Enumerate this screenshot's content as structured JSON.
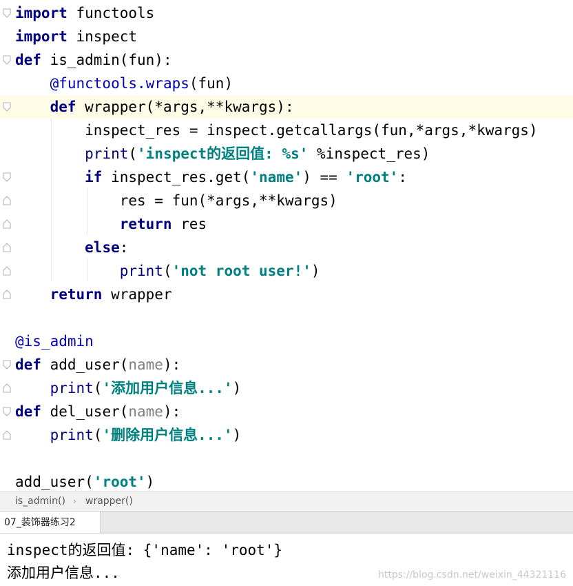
{
  "editor": {
    "lines": [
      {
        "id": "l1",
        "parts": [
          {
            "t": "import",
            "c": "kw"
          },
          {
            "t": " functools",
            "c": "self"
          }
        ]
      },
      {
        "id": "l2",
        "parts": [
          {
            "t": "import",
            "c": "kw"
          },
          {
            "t": " inspect",
            "c": "self"
          }
        ]
      },
      {
        "id": "l3",
        "parts": [
          {
            "t": "def",
            "c": "kw"
          },
          {
            "t": " is_admin(fun):",
            "c": "self"
          }
        ]
      },
      {
        "id": "l4",
        "parts": [
          {
            "t": "    ",
            "c": "self"
          },
          {
            "t": "@functools.wraps",
            "c": "deco"
          },
          {
            "t": "(fun)",
            "c": "self"
          }
        ]
      },
      {
        "id": "l5",
        "parts": [
          {
            "t": "    ",
            "c": "self"
          },
          {
            "t": "def",
            "c": "kw"
          },
          {
            "t": " wrapper(*args,**kwargs):",
            "c": "self"
          }
        ]
      },
      {
        "id": "l6",
        "parts": [
          {
            "t": "        inspect_res = inspect.getcallargs(fun,*args,*kwargs)",
            "c": "self"
          }
        ]
      },
      {
        "id": "l7",
        "parts": [
          {
            "t": "        ",
            "c": "self"
          },
          {
            "t": "print",
            "c": "bi"
          },
          {
            "t": "(",
            "c": "self"
          },
          {
            "t": "'inspect的返回值: %s'",
            "c": "str"
          },
          {
            "t": " %inspect_res)",
            "c": "self"
          }
        ]
      },
      {
        "id": "l8",
        "parts": [
          {
            "t": "        ",
            "c": "self"
          },
          {
            "t": "if",
            "c": "kw"
          },
          {
            "t": " inspect_res.get(",
            "c": "self"
          },
          {
            "t": "'name'",
            "c": "str"
          },
          {
            "t": ") == ",
            "c": "self"
          },
          {
            "t": "'root'",
            "c": "str"
          },
          {
            "t": ":",
            "c": "self"
          }
        ]
      },
      {
        "id": "l9",
        "parts": [
          {
            "t": "            res = fun(*args,**kwargs)",
            "c": "self"
          }
        ]
      },
      {
        "id": "l10",
        "parts": [
          {
            "t": "            ",
            "c": "self"
          },
          {
            "t": "return",
            "c": "kw"
          },
          {
            "t": " res",
            "c": "self"
          }
        ]
      },
      {
        "id": "l11",
        "parts": [
          {
            "t": "        ",
            "c": "self"
          },
          {
            "t": "else",
            "c": "kw"
          },
          {
            "t": ":",
            "c": "self"
          }
        ]
      },
      {
        "id": "l12",
        "parts": [
          {
            "t": "            ",
            "c": "self"
          },
          {
            "t": "print",
            "c": "bi"
          },
          {
            "t": "(",
            "c": "self"
          },
          {
            "t": "'not root user!'",
            "c": "str"
          },
          {
            "t": ")",
            "c": "self"
          }
        ]
      },
      {
        "id": "l13",
        "parts": [
          {
            "t": "    ",
            "c": "self"
          },
          {
            "t": "return",
            "c": "kw"
          },
          {
            "t": " wrapper",
            "c": "self"
          }
        ]
      },
      {
        "id": "l14",
        "parts": [
          {
            "t": "",
            "c": "self"
          }
        ]
      },
      {
        "id": "l15",
        "parts": [
          {
            "t": "@is_admin",
            "c": "deco"
          }
        ]
      },
      {
        "id": "l16",
        "parts": [
          {
            "t": "def",
            "c": "kw"
          },
          {
            "t": " add_user(",
            "c": "self"
          },
          {
            "t": "name",
            "c": "param"
          },
          {
            "t": "):",
            "c": "self"
          }
        ]
      },
      {
        "id": "l17",
        "parts": [
          {
            "t": "    ",
            "c": "self"
          },
          {
            "t": "print",
            "c": "bi"
          },
          {
            "t": "(",
            "c": "self"
          },
          {
            "t": "'添加用户信息...'",
            "c": "str"
          },
          {
            "t": ")",
            "c": "self"
          }
        ]
      },
      {
        "id": "l18",
        "parts": [
          {
            "t": "def",
            "c": "kw"
          },
          {
            "t": " del_user(",
            "c": "self"
          },
          {
            "t": "name",
            "c": "param"
          },
          {
            "t": "):",
            "c": "self"
          }
        ]
      },
      {
        "id": "l19",
        "parts": [
          {
            "t": "    ",
            "c": "self"
          },
          {
            "t": "print",
            "c": "bi"
          },
          {
            "t": "(",
            "c": "self"
          },
          {
            "t": "'删除用户信息...'",
            "c": "str"
          },
          {
            "t": ")",
            "c": "self"
          }
        ]
      },
      {
        "id": "l20",
        "parts": [
          {
            "t": "",
            "c": "self"
          }
        ]
      },
      {
        "id": "l21",
        "parts": [
          {
            "t": "add_user(",
            "c": "self"
          },
          {
            "t": "'root'",
            "c": "str"
          },
          {
            "t": ")",
            "c": "self"
          }
        ]
      }
    ]
  },
  "breadcrumb": {
    "items": [
      "is_admin()",
      "wrapper()"
    ]
  },
  "run_panel": {
    "tab_label": "07_装饰器练习2",
    "output": [
      "inspect的返回值: {'name': 'root'}",
      "添加用户信息..."
    ]
  },
  "watermark": "https://blog.csdn.net/weixin_44321116",
  "colors": {
    "keyword": "#000080",
    "string": "#008080",
    "decorator": "#0000b2",
    "current_line": "#fefbe6"
  }
}
